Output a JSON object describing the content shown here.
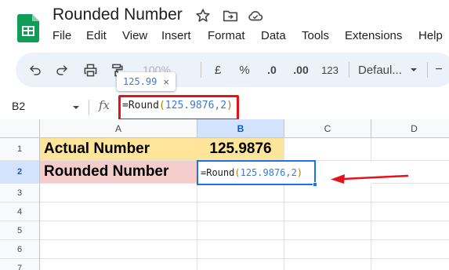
{
  "app": {
    "title": "Rounded Number",
    "menu": [
      "File",
      "Edit",
      "View",
      "Insert",
      "Format",
      "Data",
      "Tools",
      "Extensions",
      "Help"
    ]
  },
  "toolbar": {
    "zoom": "100%",
    "currency": "£",
    "percent": "%",
    "decimal_decrease": ".0",
    "decimal_increase": ".00",
    "more_formats": "123",
    "font": "Defaul...",
    "font_size_minus": "−"
  },
  "tooltip": {
    "value": "125.99",
    "close": "×"
  },
  "formula_bar": {
    "cell_ref": "B2",
    "fx": "fx",
    "fn": "=Round",
    "open": "(",
    "args": "125.9876,2",
    "close": ")"
  },
  "grid": {
    "columns": [
      "A",
      "B",
      "C",
      "D"
    ],
    "rows": [
      "1",
      "2",
      "3",
      "4",
      "5",
      "6",
      "7"
    ],
    "a1": "Actual Number",
    "b1": "125.9876",
    "a2": "Rounded Number",
    "b2": {
      "fn": "=Round",
      "open": "(",
      "args": "125.9876,2",
      "close": ")"
    }
  },
  "colors": {
    "accent_selection": "#1a73e8",
    "highlight_red": "#e8101a",
    "row1_fill": "#ffe599",
    "row2_fill": "#f4cccc",
    "toolbar_bg": "#edf2fa"
  },
  "icons": [
    "sheets-logo",
    "star-icon",
    "move-folder-icon",
    "cloud-saved-icon",
    "undo-icon",
    "redo-icon",
    "print-icon",
    "paint-format-icon",
    "chevron-down-icon",
    "close-icon",
    "arrow-icon"
  ]
}
